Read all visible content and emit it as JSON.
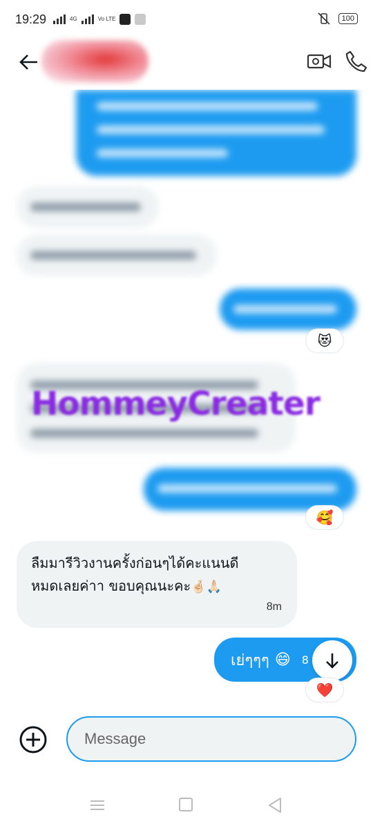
{
  "status_bar": {
    "time": "19:29",
    "network": "4G",
    "volte": "Vo LTE",
    "battery": "100"
  },
  "header": {
    "back_icon": "arrow-left-icon",
    "video_icon": "video-camera-icon",
    "call_icon": "phone-icon"
  },
  "watermark": "HommeyCreater",
  "messages": {
    "incoming_last": {
      "line1": "ลืมมารีวิวงานครั้งก่อนๆได้คะแนนดี",
      "line2": "หมดเลยค่าา ขอบคุณนะคะ",
      "emojis": "🤞🏻🙏🏻",
      "time": "8m"
    },
    "outgoing_last": {
      "text": "เย่ๆๆๆ",
      "emoji": "😄",
      "time": "8"
    }
  },
  "reactions": {
    "r1": "😻",
    "r2": "🥰",
    "r3": "❤️"
  },
  "composer": {
    "placeholder": "Message"
  },
  "colors": {
    "accent": "#1d9bf0",
    "incoming_bg": "#eff3f4",
    "watermark": "#8a2be2"
  }
}
